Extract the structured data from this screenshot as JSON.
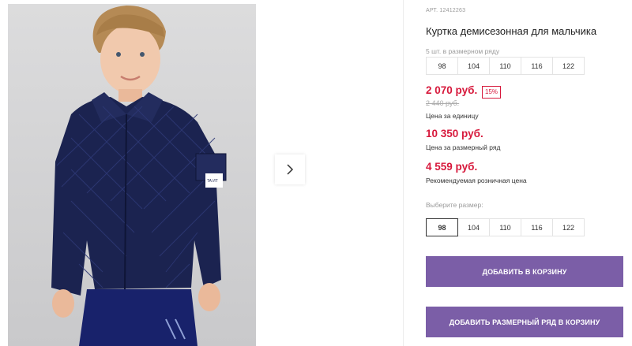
{
  "product": {
    "article": "АРТ. 12412263",
    "title": "Куртка демисезонная для мальчика"
  },
  "size_row": {
    "label": "5 шт. в размерном ряду",
    "sizes": [
      "98",
      "104",
      "110",
      "116",
      "122"
    ]
  },
  "prices": {
    "unit_price": "2 070 руб.",
    "discount": "15%",
    "old_price": "2 440 руб.",
    "unit_caption": "Цена за единицу",
    "row_price": "10 350 руб.",
    "row_caption": "Цена за размерный ряд",
    "retail_price": "4 559 руб.",
    "retail_caption": "Рекомендуемая розничная цена"
  },
  "size_select": {
    "label": "Выберите размер:",
    "sizes": [
      "98",
      "104",
      "110",
      "116",
      "122"
    ],
    "selected": "98"
  },
  "buttons": {
    "add_to_cart": "ДОБАВИТЬ В КОРЗИНУ",
    "add_row_to_cart": "ДОБАВИТЬ РАЗМЕРНЫЙ РЯД В КОРЗИНУ"
  },
  "colors": {
    "accent": "#7b5ea7",
    "price_red": "#d7193c",
    "jacket_navy": "#1b2350"
  },
  "icons": {
    "next": "chevron-right-icon"
  },
  "photo": {
    "brand_tag": "TA ИТ"
  }
}
